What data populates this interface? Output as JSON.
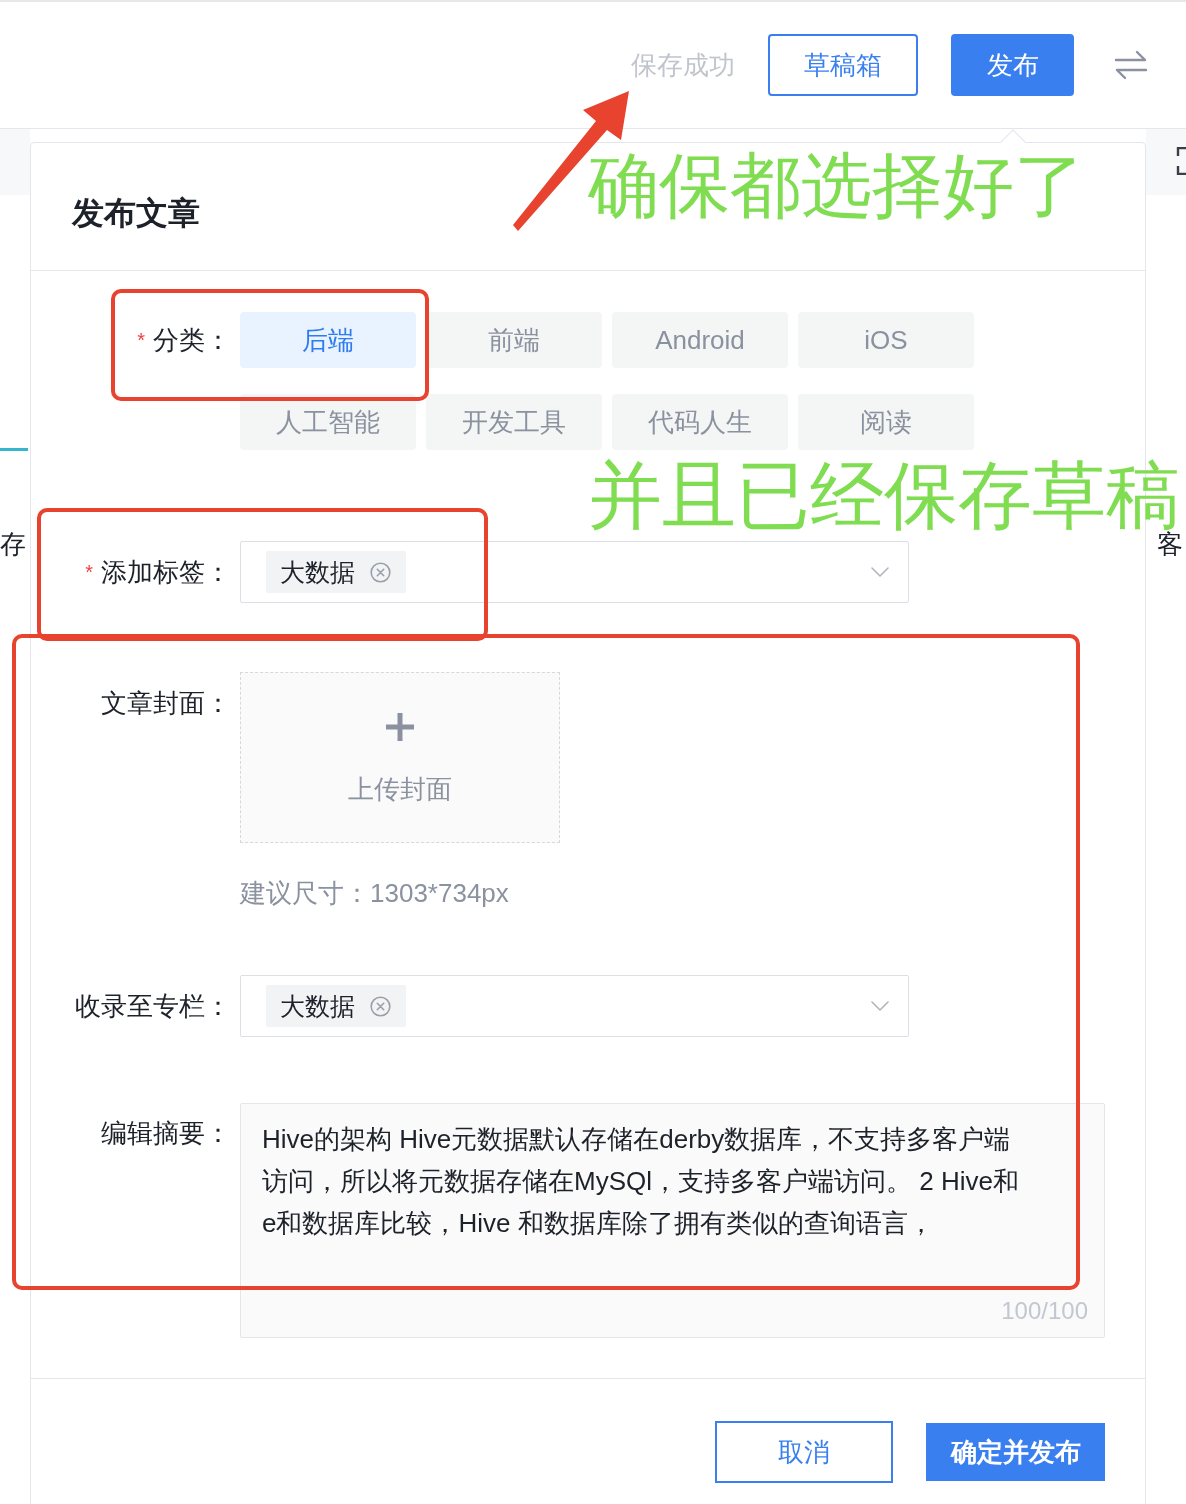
{
  "top_bar": {
    "status": "保存成功",
    "buttons": [
      {
        "label": "草稿箱",
        "kind": "outline"
      },
      {
        "label": "发布",
        "kind": "primary"
      }
    ]
  },
  "background_page": {
    "left_text": "存",
    "right_text": "客"
  },
  "dialog": {
    "title": "发布文章",
    "fields": [
      {
        "kind": "category",
        "label": "分类：",
        "required_mark": "*",
        "options": [
          {
            "label": "后端",
            "selected": true
          },
          {
            "label": "前端",
            "selected": false
          },
          {
            "label": "Android",
            "selected": false
          },
          {
            "label": "iOS",
            "selected": false
          },
          {
            "label": "人工智能",
            "selected": false
          },
          {
            "label": "开发工具",
            "selected": false
          },
          {
            "label": "代码人生",
            "selected": false
          },
          {
            "label": "阅读",
            "selected": false
          }
        ]
      },
      {
        "kind": "tags",
        "label": "添加标签：",
        "required_mark": "*",
        "chips": [
          "大数据"
        ]
      },
      {
        "kind": "cover",
        "label": "文章封面：",
        "upload_text": "上传封面",
        "hint": "建议尺寸：1303*734px"
      },
      {
        "kind": "tags",
        "label": "收录至专栏：",
        "chips": [
          "大数据"
        ]
      },
      {
        "kind": "summary",
        "label": "编辑摘要：",
        "value_lines": [
          "Hive的架构 Hive元数据默认存储在derby数据库，不支持多客户端",
          "访问，所以将元数据存储在MySQl，支持多客户端访问。 2 Hive和",
          "e和数据库比较，Hive 和数据库除了拥有类似的查询语言，"
        ],
        "counter": "100/100"
      }
    ],
    "buttons": [
      {
        "label": "取消",
        "kind": "outline"
      },
      {
        "label": "确定并发布",
        "kind": "primary"
      }
    ]
  },
  "annotations": [
    "确保都选择好了",
    "并且已经保存草稿"
  ]
}
